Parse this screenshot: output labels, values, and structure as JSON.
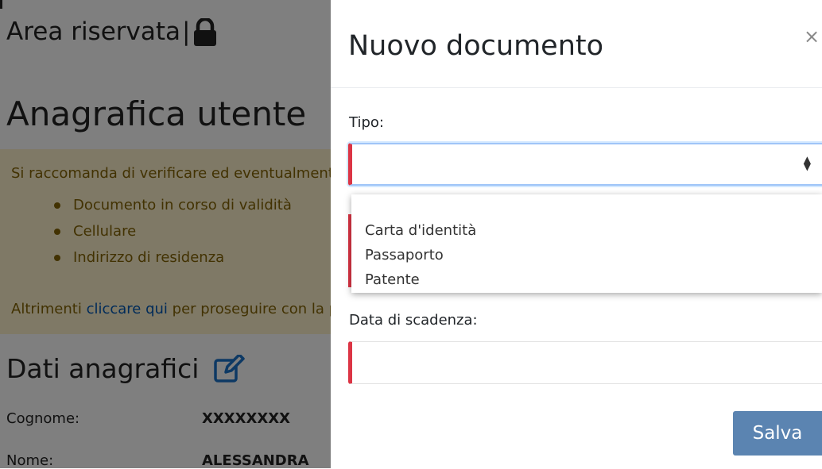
{
  "page": {
    "area_title": "Area riservata",
    "area_separator": "|",
    "title": "Anagrafica utente",
    "notice": {
      "intro": "Si raccomanda di verificare ed eventualmente aggiornare i seguenti dati:",
      "items": [
        "Documento in corso di validità",
        "Cellulare",
        "Indirizzo di residenza"
      ],
      "outro_before": "Altrimenti ",
      "outro_link": "cliccare qui",
      "outro_after": " per proseguire con la prenotazione"
    },
    "section_title": "Dati anagrafici",
    "rows": [
      {
        "label": "Cognome:",
        "value": "XXXXXXXX"
      },
      {
        "label": "Nome:",
        "value": "ALESSANDRA"
      }
    ]
  },
  "modal": {
    "title": "Nuovo documento",
    "close_label": "×",
    "tipo_label": "Tipo:",
    "tipo_value": "",
    "options": [
      "Carta d'identità",
      "Passaporto",
      "Patente"
    ],
    "scadenza_label": "Data di scadenza:",
    "scadenza_value": "",
    "save_label": "Salva"
  },
  "colors": {
    "invalid": "#dc3545",
    "save_button": "#5b84b1",
    "notice_bg": "#fff3cd",
    "link": "#0056b3"
  },
  "icons": {
    "lock": "lock-icon",
    "edit": "edit-icon",
    "close": "close-icon",
    "select_arrows": "select-arrows-icon"
  }
}
